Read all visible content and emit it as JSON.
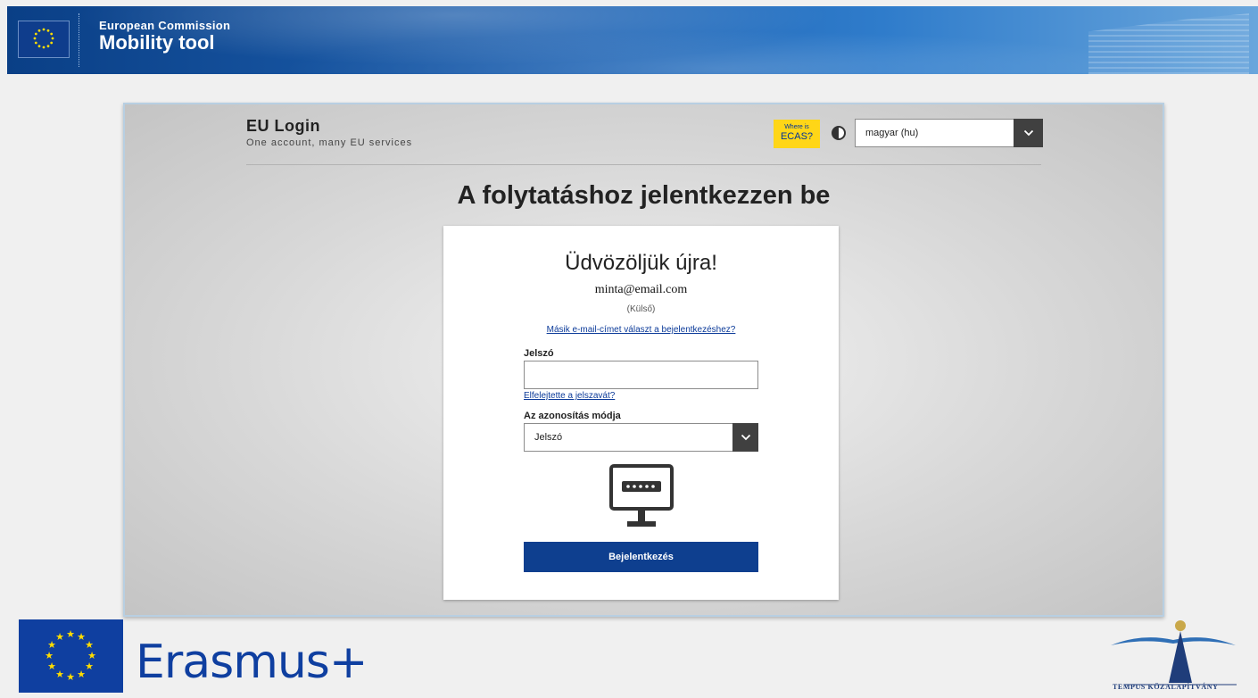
{
  "header": {
    "org": "European Commission",
    "app": "Mobility tool"
  },
  "eulogin": {
    "brand_title": "EU Login",
    "brand_subtitle": "One account, many EU services",
    "ecas_small": "Where is",
    "ecas_big": "ECAS?",
    "language_value": "magyar (hu)",
    "page_title": "A folytatáshoz jelentkezzen be"
  },
  "card": {
    "welcome": "Üdvözöljük újra!",
    "email": "minta@email.com",
    "account_type": "(Külső)",
    "other_email_link": "Másik e-mail-címet választ a bejelentkezéshez?",
    "password_label": "Jelszó",
    "password_value": "",
    "forgot_link": "Elfelejtette a jelszavát?",
    "method_label": "Az azonosítás módja",
    "method_value": "Jelszó",
    "login_button": "Bejelentkezés"
  },
  "footer": {
    "erasmus": "Erasmus+",
    "tempus": "TEMPUS KÖZALAPÍTVÁNY"
  },
  "colors": {
    "ec_blue": "#0a3f86",
    "ecas_yellow": "#ffd617",
    "login_button": "#0e3f8f",
    "link": "#0b3a99",
    "erasmus_blue": "#0f3fa0"
  },
  "icons": [
    "eu-flag-icon",
    "contrast-icon",
    "chevron-down-icon",
    "monitor-password-icon",
    "erasmus-flag-icon",
    "tempus-logo-icon"
  ]
}
